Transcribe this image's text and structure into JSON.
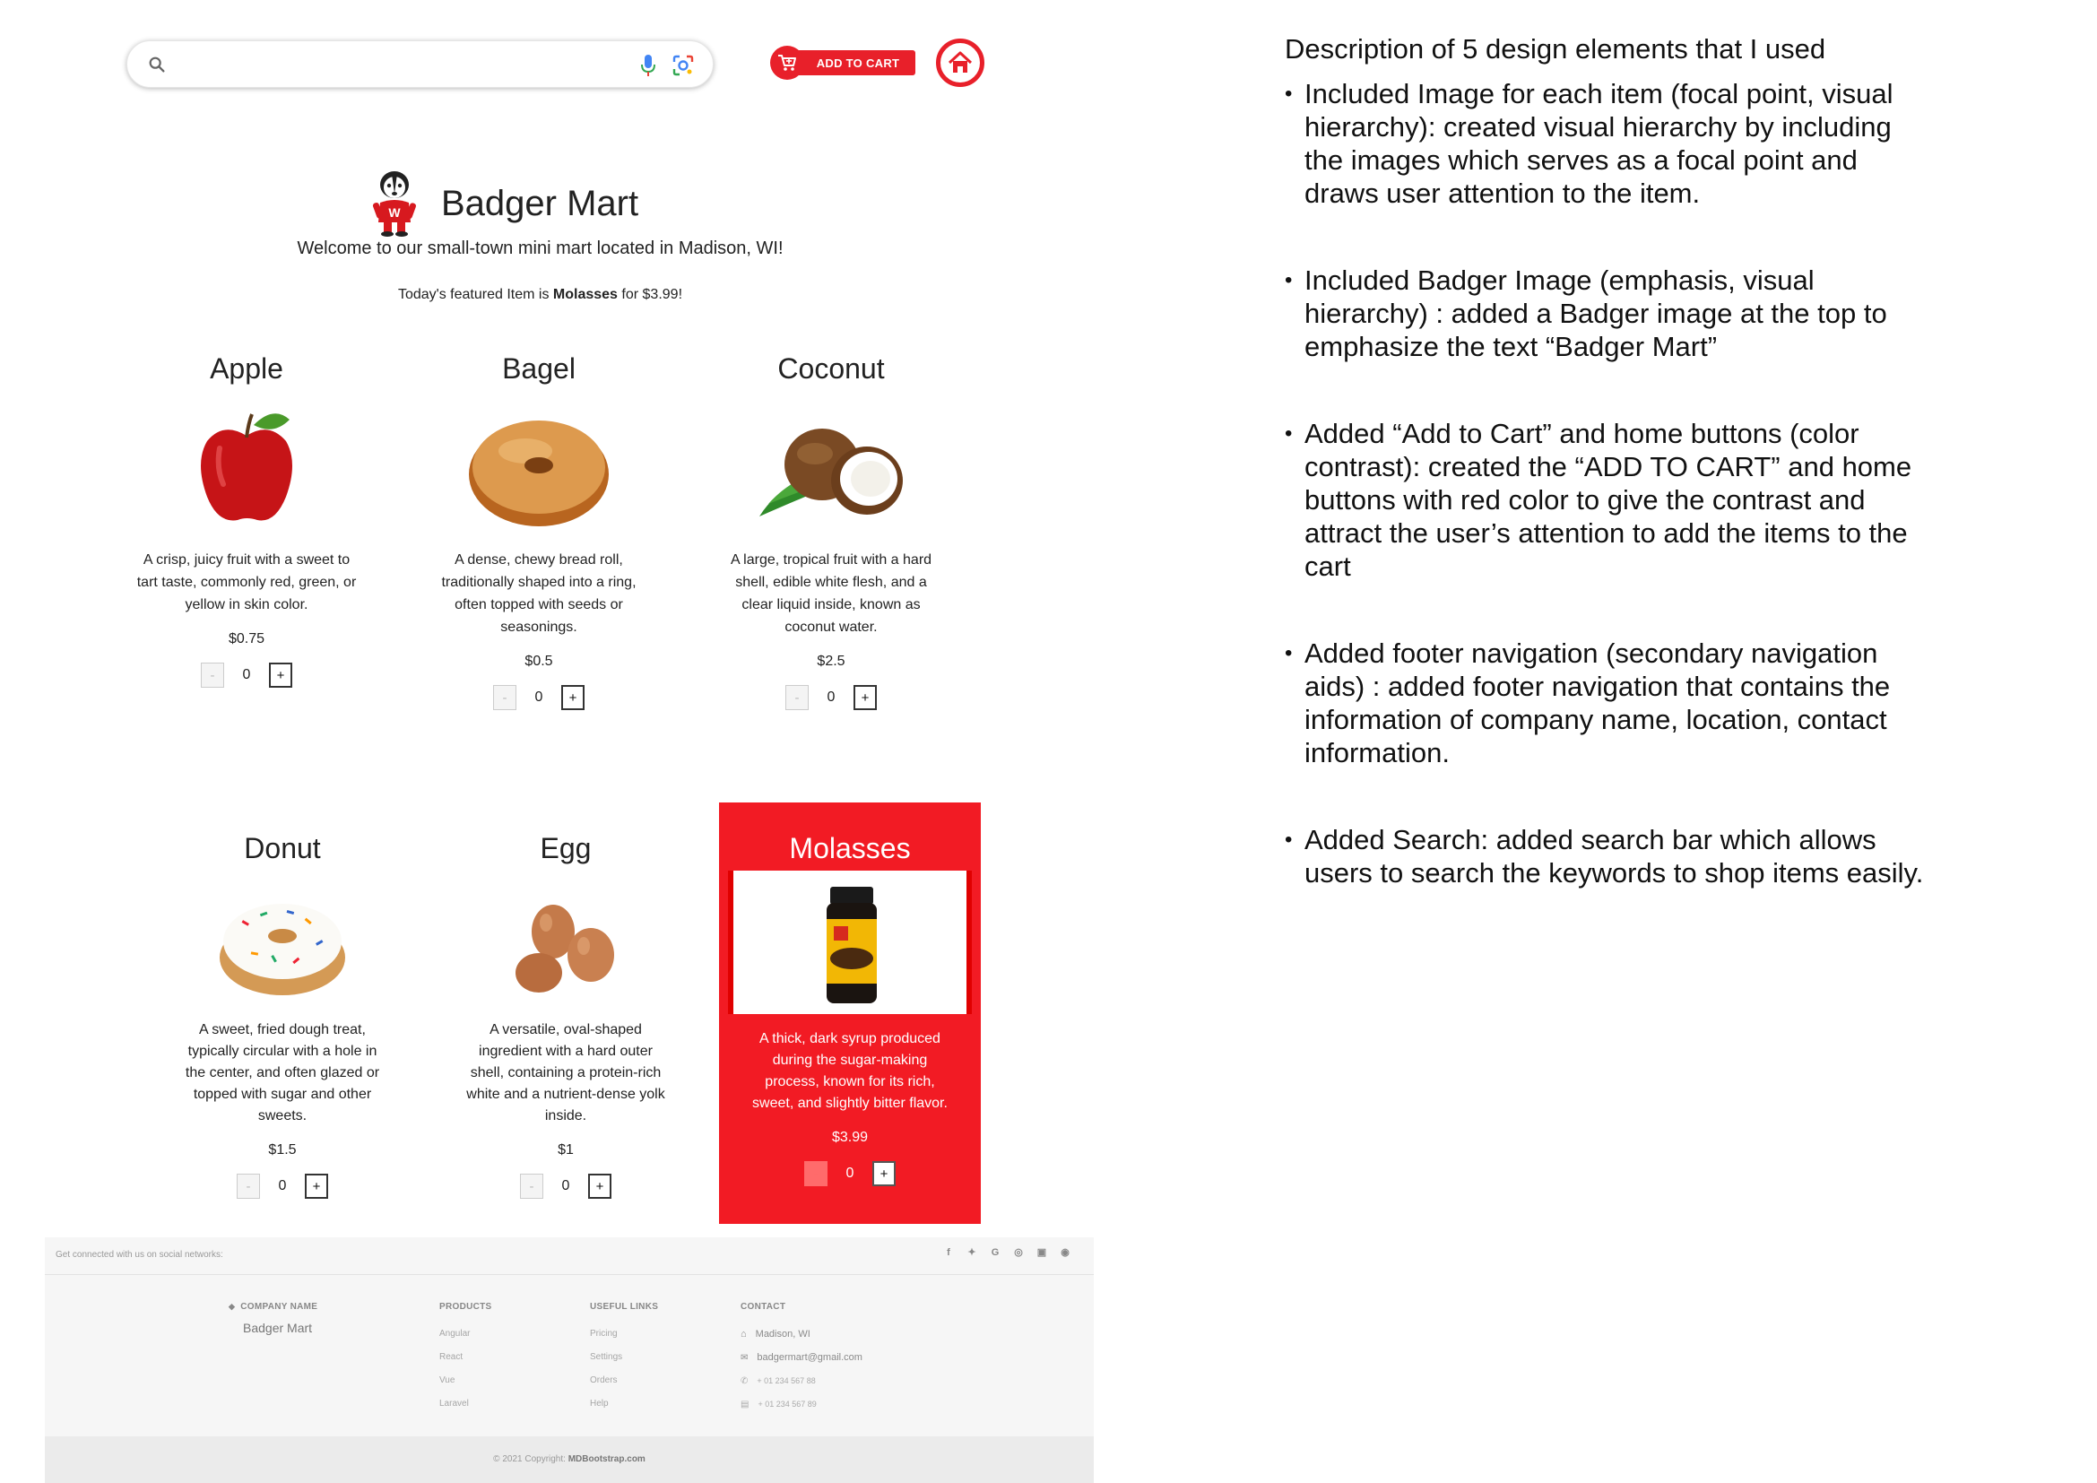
{
  "search": {
    "placeholder": "",
    "value": ""
  },
  "header": {
    "add_to_cart_label": "ADD TO CART",
    "brand_title": "Badger Mart",
    "welcome_text": "Welcome to our small-town mini mart located in Madison, WI!",
    "featured_prefix": "Today's featured Item is",
    "featured_item": "Molasses",
    "featured_suffix": "for $3.99!"
  },
  "products": [
    {
      "name": "Apple",
      "description": "A crisp, juicy fruit with a sweet to tart taste, commonly red, green, or yellow in skin color.",
      "price": "$0.75",
      "quantity": "0",
      "minus": "-",
      "plus": "+"
    },
    {
      "name": "Bagel",
      "description": "A dense, chewy bread roll, traditionally shaped into a ring, often topped with seeds or seasonings.",
      "price": "$0.5",
      "quantity": "0",
      "minus": "-",
      "plus": "+"
    },
    {
      "name": "Coconut",
      "description": "A large, tropical fruit with a hard shell, edible white flesh, and a clear liquid inside, known as coconut water.",
      "price": "$2.5",
      "quantity": "0",
      "minus": "-",
      "plus": "+"
    },
    {
      "name": "Donut",
      "description": "A sweet, fried dough treat, typically circular with a hole in the center, and often glazed or topped with sugar and other sweets.",
      "price": "$1.5",
      "quantity": "0",
      "minus": "-",
      "plus": "+"
    },
    {
      "name": "Egg",
      "description": "A versatile, oval-shaped ingredient with a hard outer shell, containing a protein-rich white and a nutrient-dense yolk inside.",
      "price": "$1",
      "quantity": "0",
      "minus": "-",
      "plus": "+"
    },
    {
      "name": "Molasses",
      "description": "A thick, dark syrup produced during the sugar-making process, known for its rich, sweet, and slightly bitter flavor.",
      "price": "$3.99",
      "quantity": "0",
      "minus": "-",
      "plus": "+"
    }
  ],
  "footer": {
    "social_text": "Get connected with us on social networks:",
    "social_icons": [
      "facebook-icon",
      "twitter-icon",
      "google-icon",
      "instagram-icon",
      "linkedin-icon",
      "github-icon"
    ],
    "company_heading": "COMPANY NAME",
    "company_name": "Badger Mart",
    "products_heading": "PRODUCTS",
    "products_links": [
      "Angular",
      "React",
      "Vue",
      "Laravel"
    ],
    "useful_heading": "USEFUL LINKS",
    "useful_links": [
      "Pricing",
      "Settings",
      "Orders",
      "Help"
    ],
    "contact_heading": "CONTACT",
    "contact_address": "Madison, WI",
    "contact_email": "badgermart@gmail.com",
    "contact_phone": "+ 01 234 567 88",
    "contact_fax": "+ 01 234 567 89",
    "copyright_prefix": "© 2021 Copyright:",
    "copyright_brand": "MDBootstrap.com"
  },
  "description": {
    "title": "Description of 5 design elements that I used",
    "bullets": [
      "Included Image for each item (focal point, visual hierarchy): created visual hierarchy by including the images which serves as a focal point and draws user attention to the item.",
      "Included Badger Image (emphasis, visual hierarchy) : added a Badger image at the top to emphasize the text “Badger Mart”",
      "Added “Add to Cart” and home buttons (color contrast): created the “ADD TO CART” and home buttons with red color to give the contrast and attract the user’s attention to add the items to the cart",
      "Added footer navigation (secondary navigation aids) : added footer navigation that contains the information of company name, location, contact information.",
      "Added Search: added search bar which allows users to search the keywords to shop items easily."
    ]
  },
  "colors": {
    "accent": "#e8202a",
    "featured_bg": "#f21b24"
  }
}
